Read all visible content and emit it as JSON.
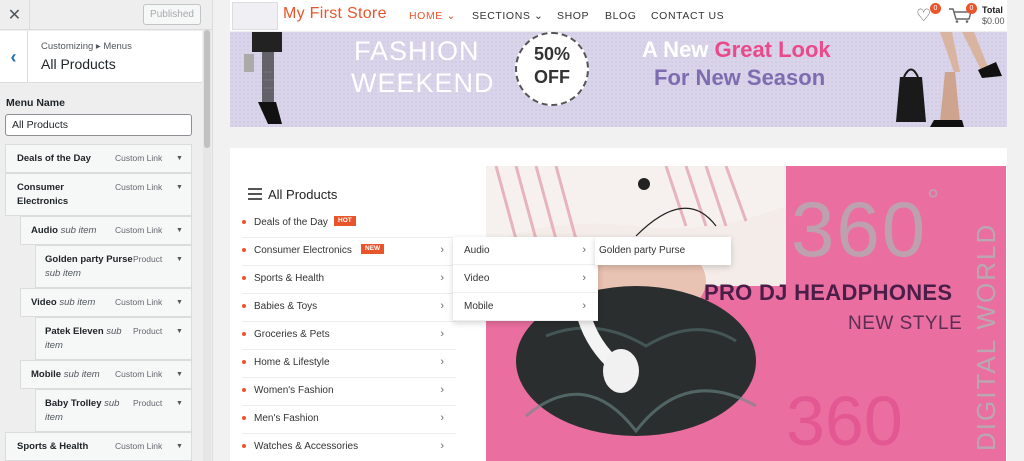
{
  "customizer": {
    "close_icon": "close-icon",
    "published_label": "Published",
    "breadcrumb": "Customizing ▸ Menus",
    "section_title": "All Products",
    "menu_name_label": "Menu Name",
    "menu_name_value": "All Products",
    "items": [
      {
        "title": "Deals of the Day",
        "sub": "",
        "type": "Custom Link"
      },
      {
        "title": "Consumer Electronics",
        "sub": "",
        "type": "Custom Link"
      },
      {
        "title": "Audio",
        "sub": "sub item",
        "type": "Custom Link"
      },
      {
        "title": "Golden party Purse",
        "sub": "sub item",
        "type": "Product"
      },
      {
        "title": "Video",
        "sub": "sub item",
        "type": "Custom Link"
      },
      {
        "title": "Patek Eleven",
        "sub": "sub item",
        "type": "Product"
      },
      {
        "title": "Mobile",
        "sub": "sub item",
        "type": "Custom Link"
      },
      {
        "title": "Baby Trolley",
        "sub": "sub item",
        "type": "Product"
      },
      {
        "title": "Sports & Health",
        "sub": "",
        "type": "Custom Link"
      }
    ]
  },
  "header": {
    "site_title": "My First Store",
    "nav": [
      "HOME",
      "SECTIONS",
      "SHOP",
      "BLOG",
      "CONTACT US"
    ],
    "wishlist_count": "0",
    "cart_count": "0",
    "total_label": "Total",
    "total_value": "$0.00"
  },
  "promo": {
    "line1": "FASHION",
    "line2": "WEEKEND",
    "discount": "50%",
    "off": "OFF",
    "new_prefix": "A New ",
    "new_highlight": "Great Look",
    "season": "For New Season"
  },
  "categories": {
    "header": "All Products",
    "items": [
      {
        "label": "Deals of the Day",
        "badge": "HOT",
        "has_children": false
      },
      {
        "label": "Consumer Electronics",
        "badge": "NEW",
        "has_children": true
      },
      {
        "label": "Sports & Health",
        "badge": "",
        "has_children": true
      },
      {
        "label": "Babies & Toys",
        "badge": "",
        "has_children": true
      },
      {
        "label": "Groceries & Pets",
        "badge": "",
        "has_children": true
      },
      {
        "label": "Home & Lifestyle",
        "badge": "",
        "has_children": true
      },
      {
        "label": "Women's Fashion",
        "badge": "",
        "has_children": true
      },
      {
        "label": "Men's Fashion",
        "badge": "",
        "has_children": true
      },
      {
        "label": "Watches & Accessories",
        "badge": "",
        "has_children": true
      }
    ],
    "submenu": [
      "Audio",
      "Video",
      "Mobile"
    ],
    "subsubmenu": [
      "Golden party Purse"
    ]
  },
  "hero": {
    "big_number": "360",
    "degree": "°",
    "title": "PRO DJ HEADPHONES",
    "subtitle": "NEW STYLE",
    "vertical_text": "DIGITAL WORLD"
  },
  "colors": {
    "accent": "#e8552b",
    "hero_bg": "#ea6fa0",
    "promo_bg": "#d9d4ea"
  }
}
